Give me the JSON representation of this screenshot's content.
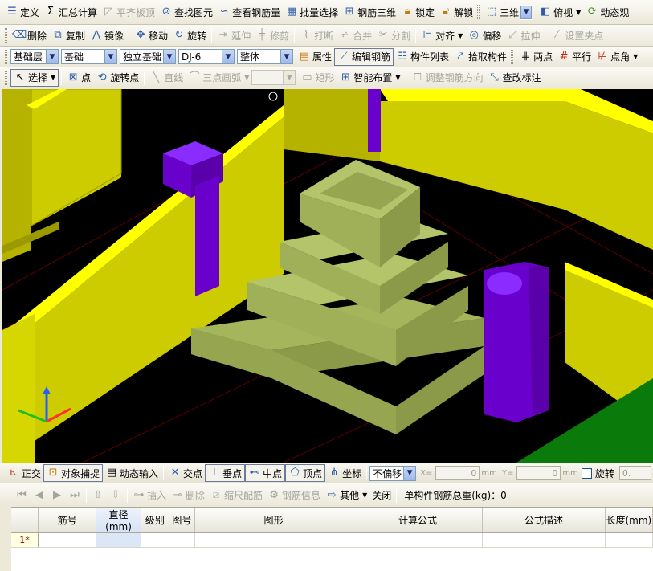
{
  "toolbar1": {
    "items": [
      {
        "label": "定义",
        "icon": "define-icon",
        "enabled": true
      },
      {
        "label": "汇总计算",
        "icon": "sigma-icon",
        "enabled": true
      },
      {
        "label": "平齐板顶",
        "icon": "align-slab-icon",
        "enabled": false
      },
      {
        "label": "查找图元",
        "icon": "binoculars-icon",
        "enabled": true
      },
      {
        "label": "查看钢筋量",
        "icon": "rebar-view-icon",
        "enabled": true
      },
      {
        "label": "批量选择",
        "icon": "batch-select-icon",
        "enabled": true
      },
      {
        "label": "钢筋三维",
        "icon": "rebar-3d-icon",
        "enabled": true
      },
      {
        "label": "锁定",
        "icon": "lock-icon",
        "enabled": true
      },
      {
        "label": "解锁",
        "icon": "unlock-icon",
        "enabled": true
      }
    ],
    "view_mode": "三维",
    "view_dir": "俯视",
    "dynamic_observe": "动态观"
  },
  "toolbar2": {
    "items": [
      {
        "label": "删除",
        "icon": "eraser-icon",
        "enabled": true
      },
      {
        "label": "复制",
        "icon": "copy-icon",
        "enabled": true
      },
      {
        "label": "镜像",
        "icon": "mirror-icon",
        "enabled": true
      },
      {
        "label": "移动",
        "icon": "move-icon",
        "enabled": true
      },
      {
        "label": "旋转",
        "icon": "rotate-icon",
        "enabled": true
      },
      {
        "label": "延伸",
        "icon": "extend-icon",
        "enabled": false
      },
      {
        "label": "修剪",
        "icon": "trim-icon",
        "enabled": false
      },
      {
        "label": "打断",
        "icon": "break-icon",
        "enabled": false
      },
      {
        "label": "合并",
        "icon": "merge-icon",
        "enabled": false
      },
      {
        "label": "分割",
        "icon": "split-icon",
        "enabled": false
      },
      {
        "label": "对齐",
        "icon": "align-icon",
        "enabled": true
      },
      {
        "label": "偏移",
        "icon": "offset-icon",
        "enabled": true
      },
      {
        "label": "拉伸",
        "icon": "stretch-icon",
        "enabled": false
      },
      {
        "label": "设置夹点",
        "icon": "grip-point-icon",
        "enabled": false
      }
    ]
  },
  "toolbar3": {
    "layer": "基础层",
    "category": "基础",
    "type": "独立基础",
    "code": "DJ-6",
    "scope": "整体",
    "properties": "属性",
    "edit_rebar": "编辑钢筋",
    "component_list": "构件列表",
    "pick_component": "拾取构件",
    "two_points": "两点",
    "parallel": "平行",
    "point_angle": "点角"
  },
  "toolbar4": {
    "select": "选择",
    "point": "点",
    "rotate_point": "旋转点",
    "line": "直线",
    "three_point_arc": "三点画弧",
    "rectangle": "矩形",
    "smart_layout": "智能布置",
    "adjust_rebar_dir": "调整钢筋方向",
    "edit_annotation": "查改标注"
  },
  "statusbar": {
    "ortho": "正交",
    "snap": "对象捕捉",
    "dynamic_input": "动态输入",
    "intersection": "交点",
    "perpendicular": "垂点",
    "midpoint": "中点",
    "vertex": "顶点",
    "coordinate": "坐标",
    "offset_mode": "不偏移",
    "x_label": "X=",
    "x_value": "0",
    "y_label": "Y=",
    "y_value": "0",
    "unit": "mm",
    "rotate": "旋转",
    "rotate_value": "0."
  },
  "rebar_panel": {
    "insert": "插入",
    "delete": "删除",
    "ruler": "缩尺配筋",
    "rebar_info": "钢筋信息",
    "other": "其他",
    "close": "关闭",
    "total_label": "单构件钢筋总重(kg)：0"
  },
  "rebar_table": {
    "columns": [
      "筋号",
      "直径(mm)",
      "级别",
      "图号",
      "图形",
      "计算公式",
      "公式描述",
      "长度(mm)"
    ],
    "rows": [
      {
        "num": "1*",
        "cells": [
          "",
          "",
          "",
          "",
          "",
          "",
          "",
          ""
        ]
      }
    ]
  },
  "colors": {
    "wall": "#cccc00",
    "wall_top": "#ffff00",
    "footing": "#a4b55c",
    "column": "#6a00cc",
    "slab": "#0a7a0a"
  }
}
